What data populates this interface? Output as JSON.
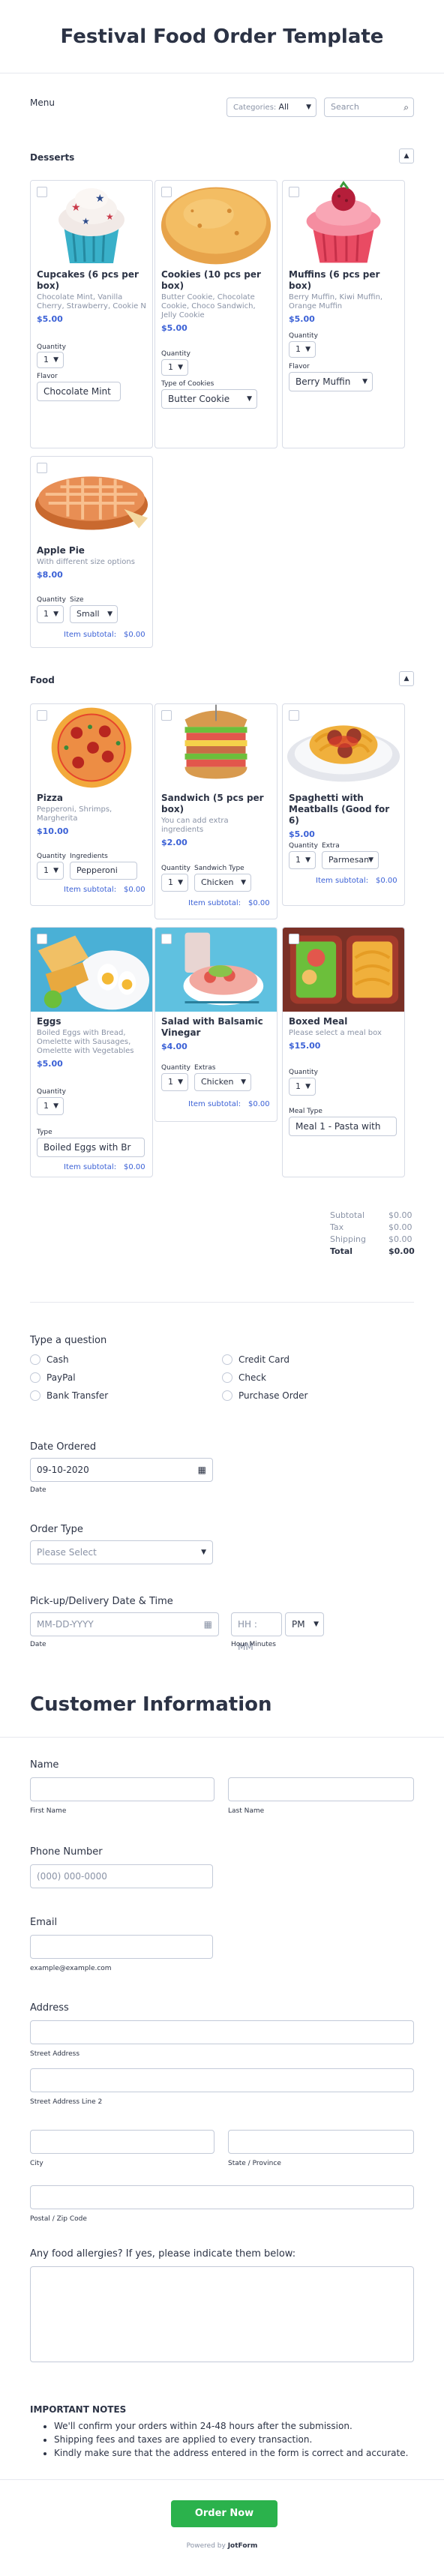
{
  "header": {
    "title": "Festival Food Order Template"
  },
  "menu": {
    "label": "Menu",
    "categories_prefix": "Categories:",
    "categories_value": "All",
    "search_placeholder": "Search"
  },
  "desserts": {
    "title": "Desserts",
    "items": [
      {
        "name": "Cupcakes (6 pcs per box)",
        "desc": "Chocolate Mint, Vanilla Cherry, Strawberry, Cookie N",
        "price": "$5.00",
        "qty_label": "Quantity",
        "qty": "1",
        "opt_label": "Flavor",
        "opt_value": "Chocolate Mint"
      },
      {
        "name": "Cookies (10 pcs per box)",
        "desc": "Butter Cookie, Chocolate Cookie, Choco Sandwich, Jelly Cookie",
        "price": "$5.00",
        "qty_label": "Quantity",
        "qty": "1",
        "opt_label": "Type of Cookies",
        "opt_value": "Butter Cookie"
      },
      {
        "name": "Muffins (6 pcs per box)",
        "desc": "Berry Muffin, Kiwi Muffin, Orange Muffin",
        "price": "$5.00",
        "qty_label": "Quantity",
        "qty": "1",
        "opt_label": "Flavor",
        "opt_value": "Berry Muffin"
      },
      {
        "name": "Apple Pie",
        "desc": "With different size options",
        "price": "$8.00",
        "qty_label": "Quantity",
        "qty": "1",
        "opt_label": "Size",
        "opt_value": "Small",
        "subtotal_label": "Item subtotal:",
        "subtotal": "$0.00"
      }
    ]
  },
  "food": {
    "title": "Food",
    "items": [
      {
        "name": "Pizza",
        "desc": "Pepperoni, Shrimps, Margherita",
        "price": "$10.00",
        "qty_label": "Quantity",
        "qty": "1",
        "opt_label": "Ingredients",
        "opt_value": "Pepperoni",
        "subtotal_label": "Item subtotal:",
        "subtotal": "$0.00"
      },
      {
        "name": "Sandwich (5 pcs per box)",
        "desc": "You can add extra ingredients",
        "price": "$2.00",
        "qty_label": "Quantity",
        "qty": "1",
        "opt_label": "Sandwich Type",
        "opt_value": "Chicken",
        "subtotal_label": "Item subtotal:",
        "subtotal": "$0.00"
      },
      {
        "name": "Spaghetti with Meatballs (Good for 6)",
        "desc": "",
        "price": "$5.00",
        "qty_label": "Quantity",
        "qty": "1",
        "opt_label": "Extra",
        "opt_value": "Parmesan",
        "subtotal_label": "Item subtotal:",
        "subtotal": "$0.00"
      },
      {
        "name": "Eggs",
        "desc": "Boiled Eggs with Bread, Omelette with Sausages, Omelette with Vegetables",
        "price": "$5.00",
        "qty_label": "Quantity",
        "qty": "1",
        "opt_label": "Type",
        "opt_value": "Boiled Eggs with Br",
        "subtotal_label": "Item subtotal:",
        "subtotal": "$0.00"
      },
      {
        "name": "Salad with Balsamic Vinegar",
        "desc": "",
        "price": "$4.00",
        "qty_label": "Quantity",
        "qty": "1",
        "opt_label": "Extras",
        "opt_value": "Chicken",
        "subtotal_label": "Item subtotal:",
        "subtotal": "$0.00"
      },
      {
        "name": "Boxed Meal",
        "desc": "Please select a meal box",
        "price": "$15.00",
        "qty_label": "Quantity",
        "qty": "1",
        "opt_label": "Meal Type",
        "opt_value": "Meal 1 - Pasta with"
      }
    ]
  },
  "totals": {
    "subtotal_label": "Subtotal",
    "subtotal": "$0.00",
    "tax_label": "Tax",
    "tax": "$0.00",
    "shipping_label": "Shipping",
    "shipping": "$0.00",
    "total_label": "Total",
    "total": "$0.00"
  },
  "question": {
    "label": "Type a question",
    "options": [
      "Cash",
      "Credit Card",
      "PayPal",
      "Check",
      "Bank Transfer",
      "Purchase Order"
    ]
  },
  "date_ordered": {
    "label": "Date Ordered",
    "value": "09-10-2020",
    "hint": "Date"
  },
  "order_type": {
    "label": "Order Type",
    "placeholder": "Please Select"
  },
  "pickup": {
    "label": "Pick-up/Delivery Date & Time",
    "date_placeholder": "MM-DD-YYYY",
    "date_hint": "Date",
    "time_placeholder": "HH : MM",
    "ampm": "PM",
    "time_hint": "Hour Minutes"
  },
  "customer": {
    "title": "Customer Information"
  },
  "name": {
    "label": "Name",
    "first_hint": "First Name",
    "last_hint": "Last Name"
  },
  "phone": {
    "label": "Phone Number",
    "placeholder": "(000) 000-0000"
  },
  "email": {
    "label": "Email",
    "hint": "example@example.com"
  },
  "address": {
    "label": "Address",
    "street": "Street Address",
    "street2": "Street Address Line 2",
    "city": "City",
    "state": "State / Province",
    "postal": "Postal / Zip Code"
  },
  "allergies": {
    "label": "Any food allergies? If yes, please indicate them below:"
  },
  "notes": {
    "title": "IMPORTANT NOTES",
    "items": [
      "We'll confirm your orders within 24-48 hours after the submission.",
      "Shipping fees and taxes are applied to every transaction.",
      "Kindly make sure that the address entered in the form is correct and accurate."
    ]
  },
  "submit": {
    "label": "Order Now"
  },
  "footer": {
    "powered": "Powered by",
    "brand": "JotForm"
  },
  "colors": {
    "accent": "#3b61d6",
    "submit": "#2bb24c",
    "text": "#2c3345",
    "border": "#c3cad8"
  }
}
